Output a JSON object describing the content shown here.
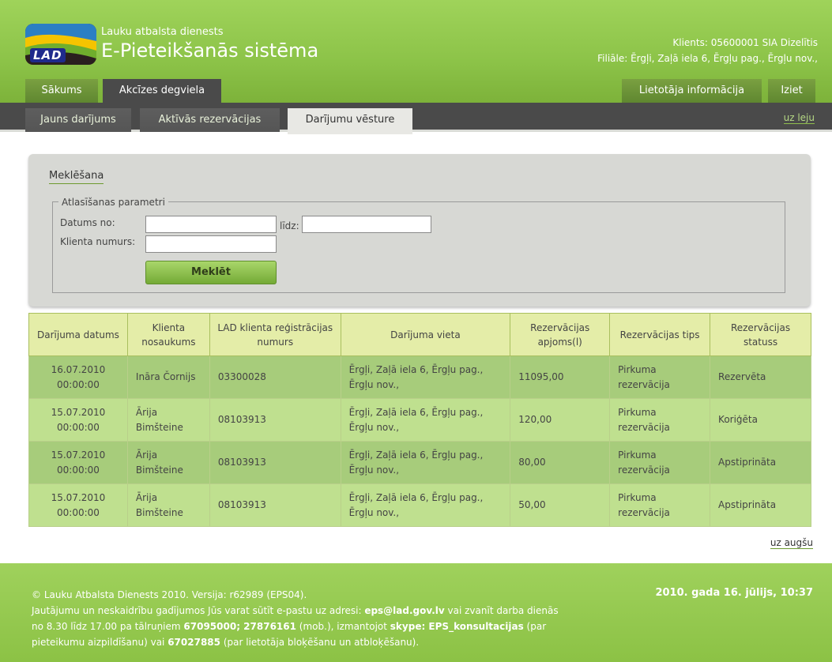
{
  "header": {
    "org_name": "Lauku atbalsta dienests",
    "system_title": "E-Pieteikšanās sistēma",
    "logo_text": "LAD",
    "client_line": "Klients: 05600001 SIA Dizelītis",
    "branch_line": "Filiāle: Ērgļi, Zaļā iela 6, Ērgļu pag., Ērgļu nov.,"
  },
  "top_tabs": {
    "home": "Sākums",
    "excise": "Akcīzes degviela",
    "user_info": "Lietotāja informācija",
    "logout": "Iziet"
  },
  "sub_tabs": {
    "new": "Jauns darījums",
    "active": "Aktīvās rezervācijas",
    "history": "Darījumu vēsture",
    "down_link": "uz leju"
  },
  "search": {
    "title": "Meklēšana",
    "legend": "Atlasīšanas parametri",
    "date_from_label": "Datums no:",
    "date_to_label": "līdz:",
    "client_number_label": "Klienta numurs:",
    "date_from_value": "",
    "date_to_value": "",
    "client_number_value": "",
    "button": "Meklēt"
  },
  "table": {
    "headers": [
      "Darījuma datums",
      "Klienta nosaukums",
      "LAD klienta reģistrācijas numurs",
      "Darījuma vieta",
      "Rezervācijas apjoms(l)",
      "Rezervācijas tips",
      "Rezervācijas statuss"
    ],
    "rows": [
      [
        "16.07.2010 00:00:00",
        "Ināra Čornijs",
        "03300028",
        "Ērgļi, Zaļā iela 6, Ērgļu pag., Ērgļu nov.,",
        "11095,00",
        "Pirkuma rezervācija",
        "Rezervēta"
      ],
      [
        "15.07.2010 00:00:00",
        "Ārija Bimšteine",
        "08103913",
        "Ērgļi, Zaļā iela 6, Ērgļu pag., Ērgļu nov.,",
        "120,00",
        "Pirkuma rezervācija",
        "Koriģēta"
      ],
      [
        "15.07.2010 00:00:00",
        "Ārija Bimšteine",
        "08103913",
        "Ērgļi, Zaļā iela 6, Ērgļu pag., Ērgļu nov.,",
        "80,00",
        "Pirkuma rezervācija",
        "Apstiprināta"
      ],
      [
        "15.07.2010 00:00:00",
        "Ārija Bimšteine",
        "08103913",
        "Ērgļi, Zaļā iela 6, Ērgļu pag., Ērgļu nov.,",
        "50,00",
        "Pirkuma rezervācija",
        "Apstiprināta"
      ]
    ],
    "up_link": "uz augšu"
  },
  "footer": {
    "line1": "© Lauku Atbalsta Dienests 2010. Versija: r62989 (EPS04).",
    "line2a": "Jautājumu un neskaidrību gadījumos Jūs varat sūtīt e-pastu uz adresi: ",
    "email": "eps@lad.gov.lv",
    "line2b": " vai zvanīt darba dienās",
    "line3a": "no 8.30 līdz 17.00 pa tālruņiem ",
    "phones": "67095000; 27876161",
    "line3b": " (mob.), izmantojot ",
    "skype": "skype: EPS_konsultacijas",
    "line3c": " (par",
    "line4a": "pieteikumu aizpildīšanu) vai ",
    "phone2": "67027885",
    "line4b": " (par lietotāja bloķēšanu un atbloķēšanu).",
    "date": "2010. gada 16. jūlijs, 10:37"
  },
  "colors": {
    "header_green": "#8cc348",
    "dark_bar": "#4a4a4a",
    "row_dark": "#a7cc7b",
    "row_light": "#bfe08f",
    "table_header": "#e4eda8"
  }
}
